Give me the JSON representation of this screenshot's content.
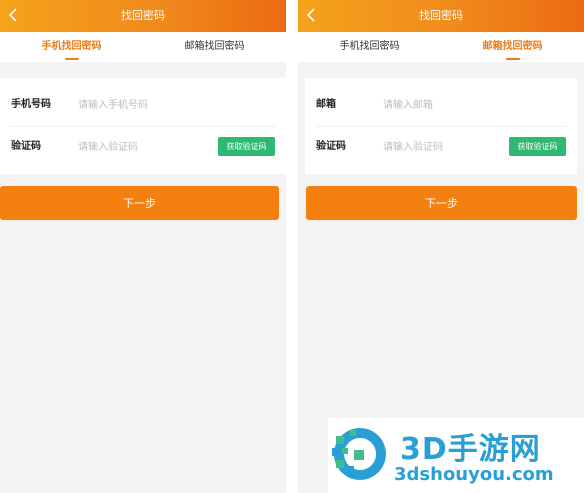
{
  "colors": {
    "brand_orange": "#f57f0f",
    "tab_active": "#f07d12",
    "code_button": "#2eb872",
    "watermark_blue": "#2a9fd6"
  },
  "screens": [
    {
      "header": {
        "title": "找回密码",
        "back_icon": "chevron-left-icon"
      },
      "tabs": [
        {
          "label": "手机找回密码",
          "active": true
        },
        {
          "label": "邮箱找回密码",
          "active": false
        }
      ],
      "form": {
        "row1": {
          "label": "手机号码",
          "placeholder": "请输入手机号码"
        },
        "row2": {
          "label": "验证码",
          "placeholder": "请输入验证码",
          "button": "获取验证码"
        }
      },
      "next_button": "下一步"
    },
    {
      "header": {
        "title": "找回密码",
        "back_icon": "chevron-left-icon"
      },
      "tabs": [
        {
          "label": "手机找回密码",
          "active": false
        },
        {
          "label": "邮箱找回密码",
          "active": true
        }
      ],
      "form": {
        "row1": {
          "label": "邮箱",
          "placeholder": "请输入邮箱"
        },
        "row2": {
          "label": "验证码",
          "placeholder": "请输入验证码",
          "button": "获取验证码"
        }
      },
      "next_button": "下一步"
    }
  ],
  "watermark": {
    "name": "3D手游网",
    "url": "3dshouyou.com"
  }
}
